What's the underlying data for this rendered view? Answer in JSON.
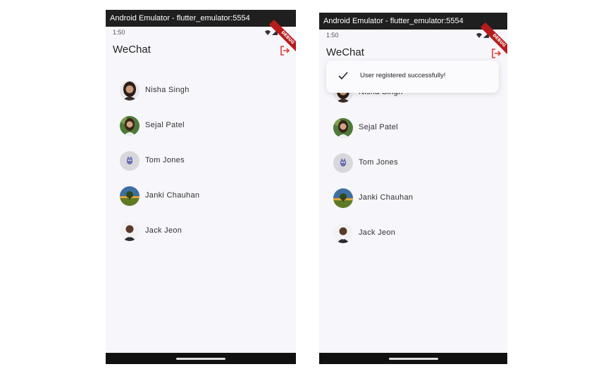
{
  "screens": [
    {
      "window_title": "Android Emulator - flutter_emulator:5554",
      "status_time": "1:50",
      "debug_banner": "DEBUG",
      "app_title": "WeChat",
      "contacts": [
        {
          "name": "Nisha Singh",
          "avatar": "woman-portrait"
        },
        {
          "name": "Sejal Patel",
          "avatar": "woman-green-background"
        },
        {
          "name": "Tom Jones",
          "avatar": "cartoon-cat"
        },
        {
          "name": "Janki Chauhan",
          "avatar": "tree-landscape"
        },
        {
          "name": "Jack Jeon",
          "avatar": "man-portrait"
        }
      ]
    },
    {
      "window_title": "Android Emulator - flutter_emulator:5554",
      "status_time": "1:50",
      "debug_banner": "DEBUG",
      "app_title": "WeChat",
      "toast_message": "User registered successfully!",
      "contacts": [
        {
          "name": "Nisha Singh",
          "avatar": "woman-portrait"
        },
        {
          "name": "Sejal Patel",
          "avatar": "woman-green-background"
        },
        {
          "name": "Tom Jones",
          "avatar": "cartoon-cat"
        },
        {
          "name": "Janki Chauhan",
          "avatar": "tree-landscape"
        },
        {
          "name": "Jack Jeon",
          "avatar": "man-portrait"
        }
      ]
    }
  ],
  "colors": {
    "accent_red": "#e53935",
    "background": "#f6f6fb",
    "titlebar": "#1f1f1f"
  }
}
